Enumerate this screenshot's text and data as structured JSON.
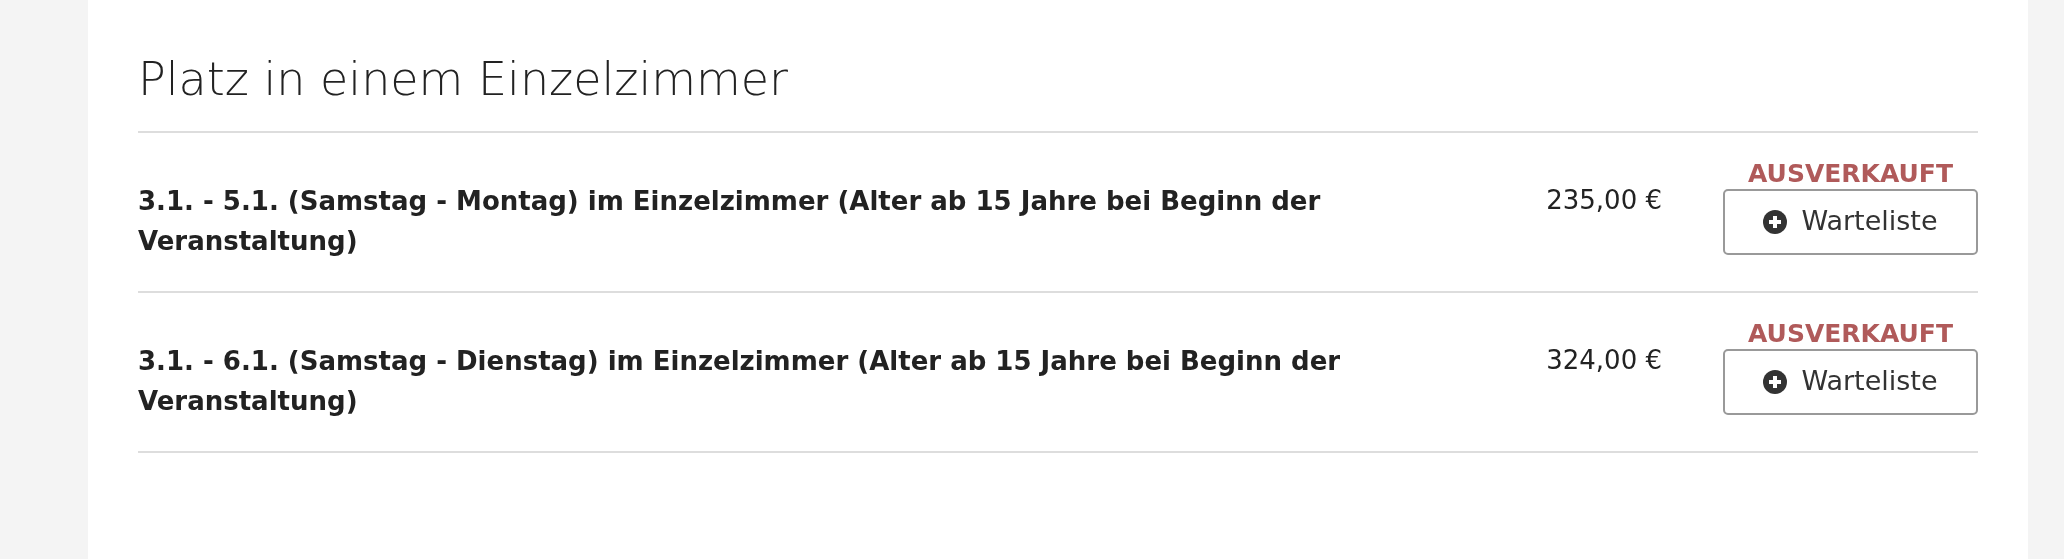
{
  "section": {
    "title": "Platz in einem Einzelzimmer"
  },
  "offers": [
    {
      "description": "3.1. - 5.1. (Samstag - Montag) im Einzelzimmer (Alter ab 15 Jahre bei Beginn der Veranstaltung)",
      "price": "235,00 €",
      "status": "AUSVERKAUFT",
      "button": "Warteliste"
    },
    {
      "description": "3.1. - 6.1. (Samstag - Dienstag) im Einzelzimmer (Alter ab 15 Jahre bei Beginn der Veranstaltung)",
      "price": "324,00 €",
      "status": "AUSVERKAUFT",
      "button": "Warteliste"
    }
  ]
}
